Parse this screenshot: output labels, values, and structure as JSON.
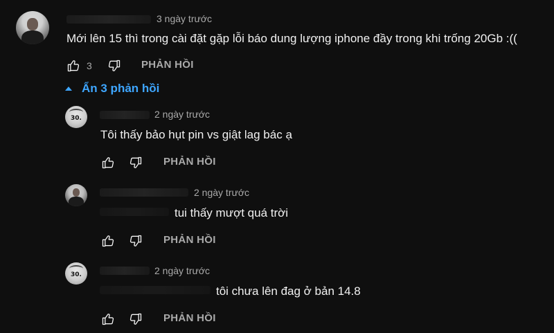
{
  "top_comment": {
    "timestamp": "3 ngày trước",
    "text": "Mới lên 15 thì trong cài đặt gặp lỗi báo dung lượng iphone đầy trong khi trống 20Gb :((",
    "like_count": "3",
    "reply_label": "PHẢN HỒI"
  },
  "replies_toggle": {
    "label": "Ẩn 3 phản hồi"
  },
  "replies": [
    {
      "timestamp": "2 ngày trước",
      "text": "Tôi thấy bảo hụt pin vs giật lag bác ạ",
      "reply_label": "PHẢN HỒI",
      "avatar_mark": "30."
    },
    {
      "timestamp": "2 ngày trước",
      "text": "tui thấy mượt quá trời",
      "reply_label": "PHẢN HỒI"
    },
    {
      "timestamp": "2 ngày trước",
      "text": "tôi chưa lên đag ở bản 14.8",
      "reply_label": "PHẢN HỒI",
      "avatar_mark": "30."
    }
  ],
  "colors": {
    "background": "#0f0f0f",
    "text": "#f1f1f1",
    "secondary": "#aaaaaa",
    "accent": "#3ea6ff"
  },
  "icons": {
    "like": "thumbs-up-icon",
    "dislike": "thumbs-down-icon",
    "toggle": "caret-up-icon"
  }
}
